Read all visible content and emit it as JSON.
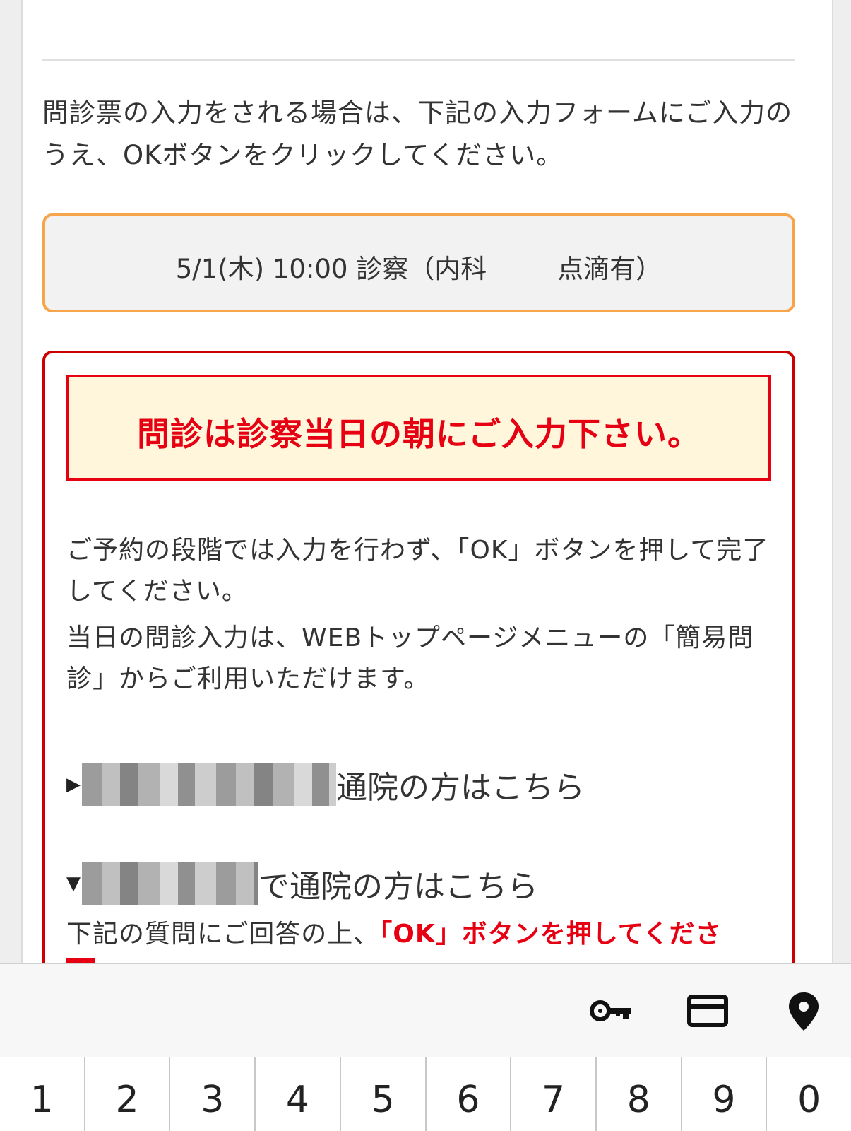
{
  "intro": {
    "text": "問診票の入力をされる場合は、下記の入力フォームにご入力のうえ、OKボタンをクリックしてください。"
  },
  "appointment": {
    "main": "5/1(木) 10:00 診察（内科",
    "tail": "点滴有）"
  },
  "notice": {
    "banner": "問診は診察当日の朝にご入力下さい。",
    "para1": "ご予約の段階では入力を行わず、「OK」ボタンを押して完了してください。",
    "para2": "当日の問診入力は、WEBトップページメニューの「簡易問診」からご利用いただけます。",
    "link1_suffix": "通院の方はこちら",
    "link2_suffix": "で通院の方はこちら",
    "answer_prefix": "下記の質問にご回答の上、",
    "answer_emphasis": "「OK」ボタンを押してくださ"
  },
  "keyboard": {
    "icons": [
      "key-icon",
      "credit-card-icon",
      "location-pin-icon"
    ],
    "numbers": [
      "1",
      "2",
      "3",
      "4",
      "5",
      "6",
      "7",
      "8",
      "9",
      "0"
    ]
  },
  "colors": {
    "accent_orange": "#f7a54a",
    "alert_red": "#e60012",
    "banner_bg": "#fff6dc"
  }
}
